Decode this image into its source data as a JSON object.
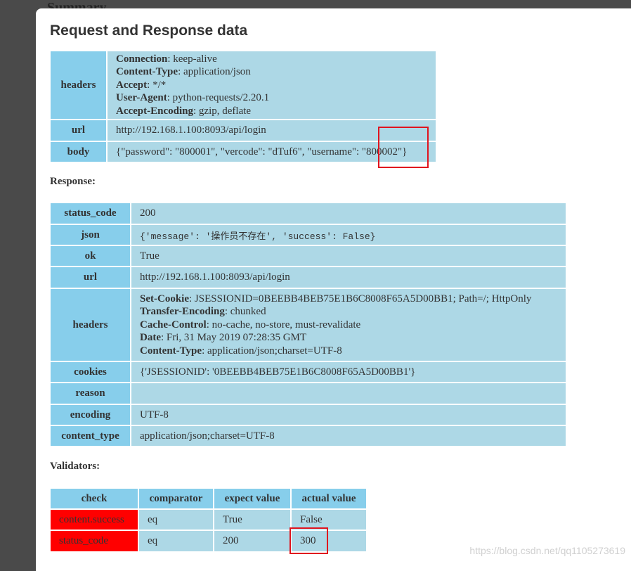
{
  "background_title": "Summary",
  "modal": {
    "title": "Request and Response data",
    "request": {
      "headers_label": "headers",
      "headers": [
        {
          "key": "Connection",
          "value": ": keep-alive"
        },
        {
          "key": "Content-Type",
          "value": ": application/json"
        },
        {
          "key": "Accept",
          "value": ": */*"
        },
        {
          "key": "User-Agent",
          "value": ": python-requests/2.20.1"
        },
        {
          "key": "Accept-Encoding",
          "value": ": gzip, deflate"
        }
      ],
      "url_label": "url",
      "url": "http://192.168.1.100:8093/api/login",
      "body_label": "body",
      "body": "{\"password\": \"800001\", \"vercode\": \"dTuf6\", \"username\": \"800002\"}"
    },
    "response_heading": "Response:",
    "response": {
      "status_code_label": "status_code",
      "status_code": "200",
      "json_label": "json",
      "json": "{'message': '操作员不存在', 'success': False}",
      "ok_label": "ok",
      "ok": "True",
      "url_label": "url",
      "url": "http://192.168.1.100:8093/api/login",
      "headers_label": "headers",
      "headers": [
        {
          "key": "Set-Cookie",
          "value": ": JSESSIONID=0BEEBB4BEB75E1B6C8008F65A5D00BB1; Path=/; HttpOnly"
        },
        {
          "key": "Transfer-Encoding",
          "value": ": chunked"
        },
        {
          "key": "Cache-Control",
          "value": ": no-cache, no-store, must-revalidate"
        },
        {
          "key": "Date",
          "value": ": Fri, 31 May 2019 07:28:35 GMT"
        },
        {
          "key": "Content-Type",
          "value": ": application/json;charset=UTF-8"
        }
      ],
      "cookies_label": "cookies",
      "cookies": "{'JSESSIONID': '0BEEBB4BEB75E1B6C8008F65A5D00BB1'}",
      "reason_label": "reason",
      "reason": "",
      "encoding_label": "encoding",
      "encoding": "UTF-8",
      "content_type_label": "content_type",
      "content_type": "application/json;charset=UTF-8"
    },
    "validators_heading": "Validators:",
    "validators": {
      "columns": [
        "check",
        "comparator",
        "expect value",
        "actual value"
      ],
      "rows": [
        {
          "check": "content.success",
          "comparator": "eq",
          "expect": "True",
          "actual": "False",
          "status": "fail"
        },
        {
          "check": "status_code",
          "comparator": "eq",
          "expect": "200",
          "actual": "300",
          "status": "fail"
        }
      ]
    },
    "fail_color": "#ff0000",
    "label_color": "#87ceeb",
    "cell_color": "#add8e6"
  },
  "watermark": "https://blog.csdn.net/qq1105273619"
}
